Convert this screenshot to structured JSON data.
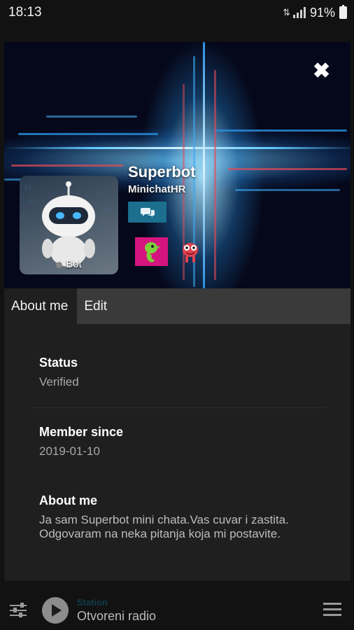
{
  "status_bar": {
    "time": "18:13",
    "battery": "91%",
    "icons": [
      "data-transfer-icon",
      "signal-icon",
      "battery-icon"
    ]
  },
  "profile": {
    "name": "Superbot",
    "room": "MinichatHR",
    "badge": "Bot",
    "close_icon": "close-icon",
    "chat_icon": "chat-bubbles-icon"
  },
  "tabs": [
    {
      "label": "About me",
      "active": true
    },
    {
      "label": "Edit",
      "active": false
    }
  ],
  "details": {
    "status": {
      "label": "Status",
      "value": "Verified"
    },
    "member_since": {
      "label": "Member since",
      "value": "2019-01-10"
    },
    "about": {
      "label": "About me",
      "value": "Ja sam Superbot mini chata.Vas cuvar i zastita. Odgovaram na neka pitanja koja mi postavite."
    }
  },
  "player": {
    "station_label": "Station",
    "station_name": "Otvoreni radio",
    "icons": [
      "equalizer-icon",
      "play-icon",
      "menu-icon"
    ]
  },
  "colors": {
    "background": "#121212",
    "panel": "#1f1f1f",
    "tab_bar": "#3a3a3a",
    "chat_button": "#1c6f8f",
    "gift_bg": "#d4157f"
  }
}
